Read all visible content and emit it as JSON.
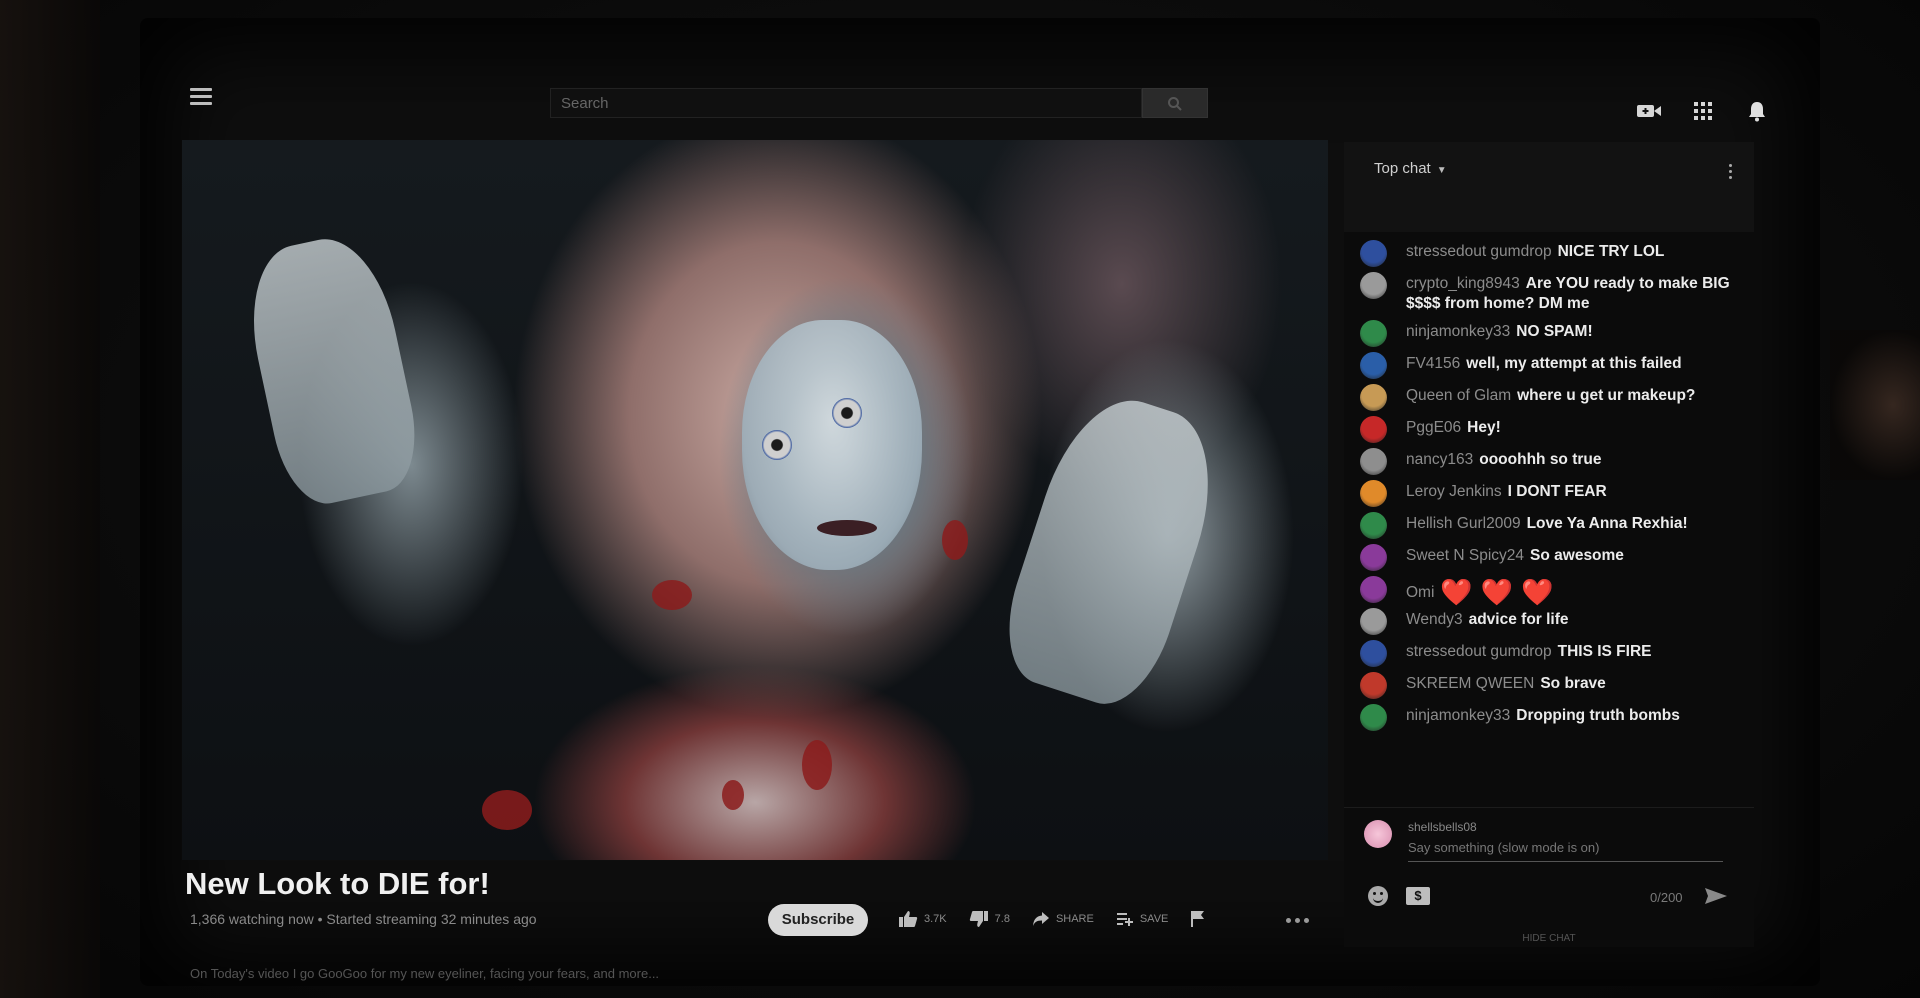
{
  "header": {
    "search_placeholder": "Search",
    "icons": [
      "menu-icon",
      "search-icon",
      "create-video-icon",
      "apps-grid-icon",
      "notifications-bell-icon"
    ]
  },
  "video": {
    "title": "New Look to DIE for!",
    "meta": "1,366 watching now • Started streaming 32 minutes ago",
    "description": "On Today's video I go GooGoo for my new eyeliner, facing your fears, and more...",
    "subscribe_label": "Subscribe",
    "likes": "3.7K",
    "dislikes": "7.8",
    "share_label": "SHARE",
    "save_label": "SAVE"
  },
  "chat": {
    "title": "Top chat",
    "messages": [
      {
        "author": "stressedout gumdrop",
        "text": "NICE TRY LOL",
        "avatar_color": "#2e4f9e"
      },
      {
        "author": "crypto_king8943",
        "text": "Are YOU ready to make BIG $$$$ from home? DM me",
        "avatar_color": "#9a9a9a"
      },
      {
        "author": "ninjamonkey33",
        "text": "NO SPAM!",
        "avatar_color": "#2f8a4a"
      },
      {
        "author": "FV4156",
        "text": "well, my attempt at this failed",
        "avatar_color": "#2a5ea8"
      },
      {
        "author": "Queen of Glam",
        "text": "where u get ur makeup?",
        "avatar_color": "#c79a55"
      },
      {
        "author": "PggE06",
        "text": "Hey!",
        "avatar_color": "#c62828"
      },
      {
        "author": "nancy163",
        "text": "oooohhh so true",
        "avatar_color": "#8e8e8e"
      },
      {
        "author": "Leroy Jenkins",
        "text": "I DONT FEAR",
        "avatar_color": "#e08a2a"
      },
      {
        "author": "Hellish Gurl2009",
        "text": "Love Ya Anna Rexhia!",
        "avatar_color": "#2f8a4a"
      },
      {
        "author": "Sweet N Spicy24",
        "text": "So awesome",
        "avatar_color": "#8a3a9a"
      },
      {
        "author": "Omi",
        "text": "❤️❤️❤️",
        "avatar_color": "#8a3a9a"
      },
      {
        "author": "Wendy3",
        "text": "advice for life",
        "avatar_color": "#9a9a9a"
      },
      {
        "author": "stressedout gumdrop",
        "text": "THIS IS FIRE",
        "avatar_color": "#2e4f9e"
      },
      {
        "author": "SKREEM QWEEN",
        "text": "So brave",
        "avatar_color": "#c0392b"
      },
      {
        "author": "ninjamonkey33",
        "text": "Dropping truth bombs",
        "avatar_color": "#2f8a4a"
      }
    ],
    "input_user": "shellsbells08",
    "input_placeholder": "Say something (slow mode is on)",
    "char_count": "0/200",
    "hide_label": "HIDE CHAT"
  }
}
